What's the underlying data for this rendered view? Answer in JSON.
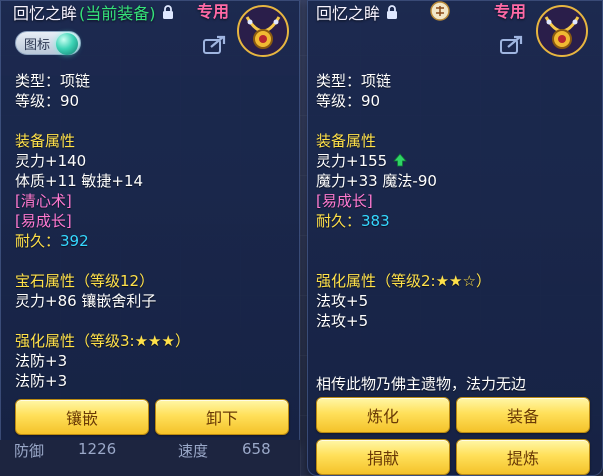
{
  "left": {
    "title": "回忆之眸",
    "title_equipped": "(当前装备)",
    "exclusive": "专用",
    "tag_button": "图标",
    "type_line": "类型：项链",
    "level_line": "等级：90",
    "equip_attr_header": "装备属性",
    "attrs": [
      "灵力+140",
      "体质+11 敏捷+14"
    ],
    "special": [
      "[清心术]",
      "[易成长]"
    ],
    "durability_label": "耐久：",
    "durability_value": "392",
    "gem_header": "宝石属性（等级12）",
    "gem_line": "灵力+86 镶嵌舍利子",
    "enhance_header": "强化属性（等级3:★★★）",
    "enhance_lines": [
      "法防+3",
      "法防+3"
    ],
    "buttons": {
      "inlay": "镶嵌",
      "unequip": "卸下"
    },
    "bottom_strip": {
      "left": "防御",
      "left_value": "1226",
      "right": "速度",
      "right_value": "658"
    }
  },
  "right": {
    "title": "回忆之眸",
    "exclusive": "专用",
    "type_line": "类型：项链",
    "level_line": "等级：90",
    "equip_attr_header": "装备属性",
    "attrs": [
      "灵力+155",
      "魔力+33 魔法-90"
    ],
    "special": [
      "[易成长]"
    ],
    "durability_label": "耐久：",
    "durability_value": "383",
    "enhance_header": "强化属性（等级2:★★☆）",
    "enhance_lines": [
      "法攻+5",
      "法攻+5"
    ],
    "description": "相传此物乃佛主遗物，法力无边",
    "buttons": {
      "refine": "炼化",
      "equip": "装备",
      "donate": "捐献",
      "extract": "提炼"
    }
  },
  "colors": {
    "section": "#ffe14a",
    "special": "#ff7ad2",
    "durability_value": "#36d8ff",
    "equipped": "#35e27a",
    "button": "#ffe05a"
  },
  "icons": [
    "lock-icon",
    "seal-badge-icon",
    "necklace-item-icon",
    "share-icon",
    "gem-orb-icon",
    "upgrade-arrow-icon"
  ]
}
